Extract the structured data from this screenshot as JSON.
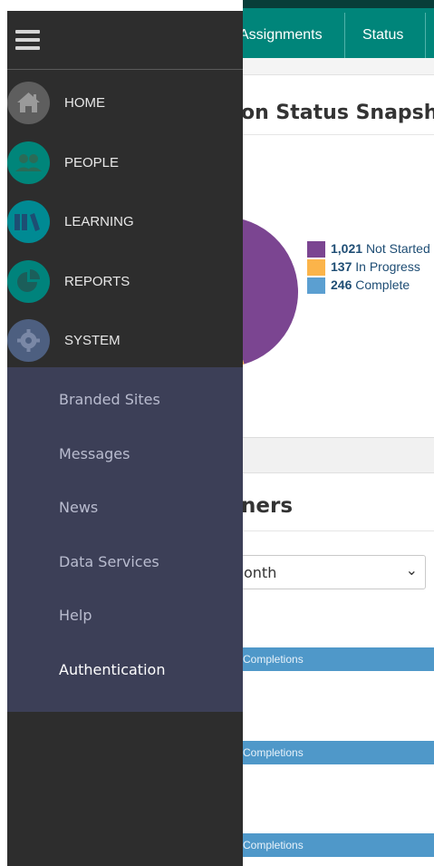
{
  "top_nav": {
    "tabs": [
      {
        "label": "Assignments"
      },
      {
        "label": "Status"
      }
    ]
  },
  "snapshot": {
    "title": "on Status Snapsh",
    "chart_data": {
      "type": "pie",
      "slices": [
        {
          "label": "Not Started",
          "value": 1021,
          "display": "1,021",
          "color": "#7b4591"
        },
        {
          "label": "In Progress",
          "value": 137,
          "display": "137",
          "color": "#fbb44a"
        },
        {
          "label": "Complete",
          "value": 246,
          "display": "246",
          "color": "#5b9fd1"
        }
      ]
    }
  },
  "learners": {
    "title": "ners",
    "select_value": "onth",
    "bars": [
      {
        "label": "Completions"
      },
      {
        "label": "Completions"
      },
      {
        "label": "Completions"
      }
    ]
  },
  "side_menu": {
    "items": [
      {
        "label": "HOME",
        "icon": "home-icon",
        "color": "#5e5e5e"
      },
      {
        "label": "PEOPLE",
        "icon": "people-icon",
        "color": "#00857a"
      },
      {
        "label": "LEARNING",
        "icon": "books-icon",
        "color": "#008a93"
      },
      {
        "label": "REPORTS",
        "icon": "pie-chart-icon",
        "color": "#00837c"
      },
      {
        "label": "SYSTEM",
        "icon": "gear-icon",
        "color": "#4d5f80"
      }
    ],
    "sub_items": [
      {
        "label": "Branded Sites",
        "active": false
      },
      {
        "label": "Messages",
        "active": false
      },
      {
        "label": "News",
        "active": false
      },
      {
        "label": "Data Services",
        "active": false
      },
      {
        "label": "Help",
        "active": false
      },
      {
        "label": "Authentication",
        "active": true
      }
    ]
  }
}
